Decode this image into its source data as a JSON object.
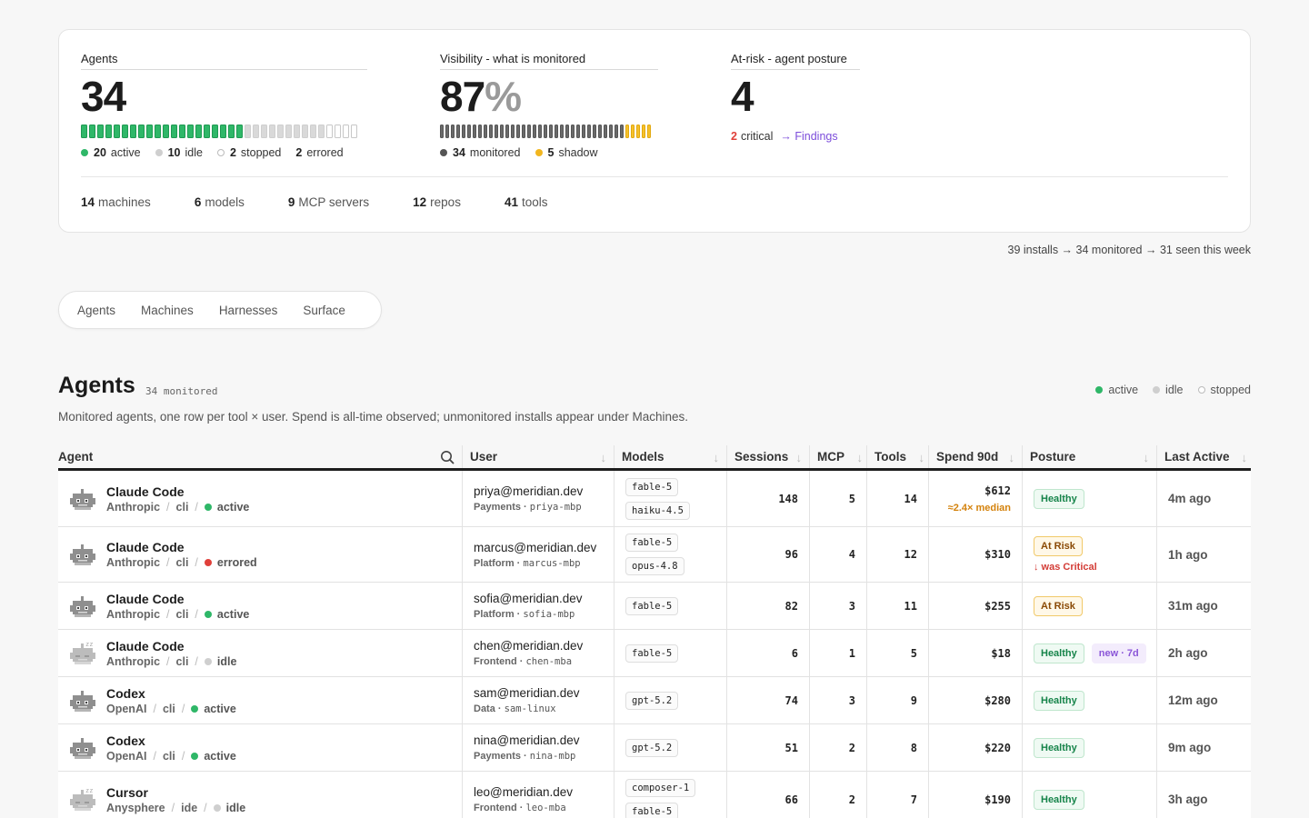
{
  "summary": {
    "agents": {
      "title": "Agents",
      "value": "34",
      "legend": [
        {
          "count": "20",
          "label": "active",
          "color": "#2fb768"
        },
        {
          "count": "10",
          "label": "idle",
          "color": "#cfcfcf"
        },
        {
          "count": "2",
          "label": "stopped",
          "color": "hollow"
        },
        {
          "count": "2",
          "label": "errored",
          "color": "none"
        }
      ]
    },
    "visibility": {
      "title": "Visibility - what is monitored",
      "value": "87",
      "unit": "%",
      "legend": [
        {
          "count": "34",
          "label": "monitored",
          "color": "#555555"
        },
        {
          "count": "5",
          "label": "shadow",
          "color": "#f2b61f"
        }
      ]
    },
    "atrisk": {
      "title": "At-risk - agent posture",
      "value": "4",
      "critical_count": "2",
      "critical_label": "critical",
      "findings_link": "→ Findings"
    },
    "counts": [
      {
        "n": "14",
        "label": "machines"
      },
      {
        "n": "6",
        "label": "models"
      },
      {
        "n": "9",
        "label": "MCP servers"
      },
      {
        "n": "12",
        "label": "repos"
      },
      {
        "n": "41",
        "label": "tools"
      }
    ]
  },
  "funnel": "39 installs → 34 monitored → 31 seen this week",
  "tabs": [
    "Agents",
    "Machines",
    "Harnesses",
    "Surface"
  ],
  "section": {
    "title": "Agents",
    "subtitle": "34 monitored",
    "description": "Monitored agents, one row per tool × user. Spend is all-time observed; unmonitored installs appear under Machines.",
    "legend": [
      {
        "label": "active",
        "color": "#2fb768"
      },
      {
        "label": "idle",
        "color": "#cfcfcf"
      },
      {
        "label": "stopped",
        "color": "hollow"
      }
    ]
  },
  "table": {
    "columns": [
      "Agent",
      "User",
      "Models",
      "Sessions",
      "MCP",
      "Tools",
      "Spend 90d",
      "Posture",
      "Last Active"
    ],
    "rows": [
      {
        "name": "Claude Code",
        "vendor": "Anthropic",
        "kind": "cli",
        "status": "active",
        "status_color": "#2fb768",
        "icon": "robot-icon",
        "email": "priya@meridian.dev",
        "team": "Payments",
        "host": "priya-mbp",
        "models": [
          "fable-5",
          "haiku-4.5"
        ],
        "sessions": "148",
        "mcp": "5",
        "tools": "14",
        "spend": "$612",
        "spend_note": "≈2.4× median",
        "posture": "Healthy",
        "posture_kind": "healthy",
        "posture_note": "",
        "extra_badge": "",
        "last": "4m ago",
        "height": 62
      },
      {
        "name": "Claude Code",
        "vendor": "Anthropic",
        "kind": "cli",
        "status": "errored",
        "status_color": "#e0403a",
        "icon": "robot-icon",
        "email": "marcus@meridian.dev",
        "team": "Platform",
        "host": "marcus-mbp",
        "models": [
          "fable-5",
          "opus-4.8"
        ],
        "sessions": "96",
        "mcp": "4",
        "tools": "12",
        "spend": "$310",
        "spend_note": "",
        "posture": "At Risk",
        "posture_kind": "atrisk",
        "posture_note": "↓ was Critical",
        "extra_badge": "",
        "last": "1h ago",
        "height": 61
      },
      {
        "name": "Claude Code",
        "vendor": "Anthropic",
        "kind": "cli",
        "status": "active",
        "status_color": "#2fb768",
        "icon": "robot-icon",
        "email": "sofia@meridian.dev",
        "team": "Platform",
        "host": "sofia-mbp",
        "models": [
          "fable-5"
        ],
        "sessions": "82",
        "mcp": "3",
        "tools": "11",
        "spend": "$255",
        "spend_note": "",
        "posture": "At Risk",
        "posture_kind": "atrisk",
        "posture_note": "",
        "extra_badge": "",
        "last": "31m ago",
        "height": 52
      },
      {
        "name": "Claude Code",
        "vendor": "Anthropic",
        "kind": "cli",
        "status": "idle",
        "status_color": "#cfcfcf",
        "icon": "sleeping-robot-icon",
        "email": "chen@meridian.dev",
        "team": "Frontend",
        "host": "chen-mba",
        "models": [
          "fable-5"
        ],
        "sessions": "6",
        "mcp": "1",
        "tools": "5",
        "spend": "$18",
        "spend_note": "",
        "posture": "Healthy",
        "posture_kind": "healthy",
        "posture_note": "",
        "extra_badge": "new · 7d",
        "last": "2h ago",
        "height": 52
      },
      {
        "name": "Codex",
        "vendor": "OpenAI",
        "kind": "cli",
        "status": "active",
        "status_color": "#2fb768",
        "icon": "robot-icon",
        "email": "sam@meridian.dev",
        "team": "Data",
        "host": "sam-linux",
        "models": [
          "gpt-5.2"
        ],
        "sessions": "74",
        "mcp": "3",
        "tools": "9",
        "spend": "$280",
        "spend_note": "",
        "posture": "Healthy",
        "posture_kind": "healthy",
        "posture_note": "",
        "extra_badge": "",
        "last": "12m ago",
        "height": 52
      },
      {
        "name": "Codex",
        "vendor": "OpenAI",
        "kind": "cli",
        "status": "active",
        "status_color": "#2fb768",
        "icon": "robot-icon",
        "email": "nina@meridian.dev",
        "team": "Payments",
        "host": "nina-mbp",
        "models": [
          "gpt-5.2"
        ],
        "sessions": "51",
        "mcp": "2",
        "tools": "8",
        "spend": "$220",
        "spend_note": "",
        "posture": "Healthy",
        "posture_kind": "healthy",
        "posture_note": "",
        "extra_badge": "",
        "last": "9m ago",
        "height": 52
      },
      {
        "name": "Cursor",
        "vendor": "Anysphere",
        "kind": "ide",
        "status": "idle",
        "status_color": "#cfcfcf",
        "icon": "sleeping-robot-icon",
        "email": "leo@meridian.dev",
        "team": "Frontend",
        "host": "leo-mba",
        "models": [
          "composer-1",
          "fable-5"
        ],
        "sessions": "66",
        "mcp": "2",
        "tools": "7",
        "spend": "$190",
        "spend_note": "",
        "posture": "Healthy",
        "posture_kind": "healthy",
        "posture_note": "",
        "extra_badge": "",
        "last": "3h ago",
        "height": 62
      }
    ]
  }
}
